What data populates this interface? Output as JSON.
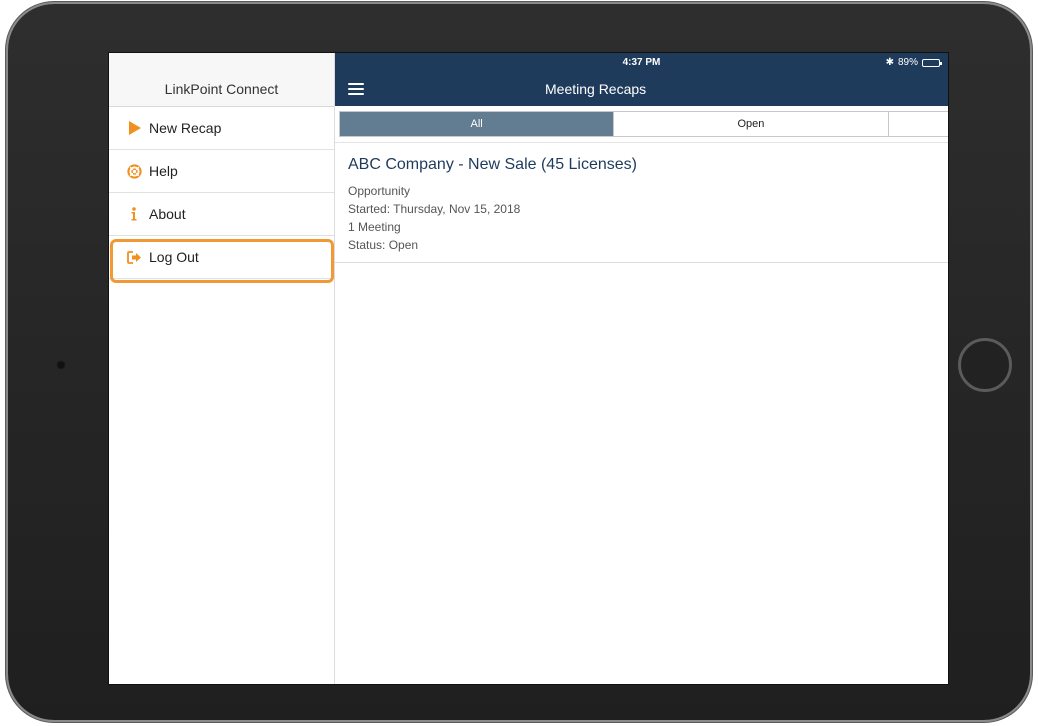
{
  "status_bar": {
    "time": "4:37 PM",
    "battery": "89%",
    "battery_level": 0.89
  },
  "sidebar": {
    "title": "LinkPoint Connect",
    "items": [
      {
        "label": "New Recap",
        "icon": "play-icon"
      },
      {
        "label": "Help",
        "icon": "lifebuoy-icon"
      },
      {
        "label": "About",
        "icon": "info-icon"
      },
      {
        "label": "Log Out",
        "icon": "sign-out-icon"
      }
    ]
  },
  "navbar": {
    "title": "Meeting Recaps"
  },
  "segments": {
    "all": "All",
    "open": "Open"
  },
  "recaps": [
    {
      "title": "ABC Company - New Sale (45 Licenses)",
      "type": "Opportunity",
      "started": "Started: Thursday, Nov 15, 2018",
      "meetings": "1 Meeting",
      "status": "Status: Open"
    }
  ],
  "colors": {
    "navbar": "#1f3b5c",
    "accent": "#f0901e",
    "segment_active": "#627c91"
  }
}
